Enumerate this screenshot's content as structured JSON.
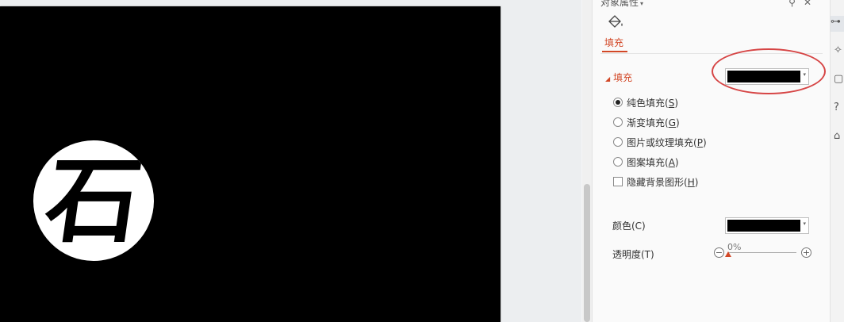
{
  "panel": {
    "title": "对象属性",
    "title_caret": "▾",
    "title_icons": [
      "pin-icon",
      "close-icon"
    ],
    "pin_glyph": "⚲",
    "close_glyph": "✕",
    "tab_fill_label": "填充",
    "section_title": "填充",
    "section_triangle": "◢",
    "fill_options": [
      {
        "label": "纯色填充(",
        "key": "S",
        "selected": true
      },
      {
        "label": "渐变填充(",
        "key": "G",
        "selected": false
      },
      {
        "label": "图片或纹理填充(",
        "key": "P",
        "selected": false
      },
      {
        "label": "图案填充(",
        "key": "A",
        "selected": false
      }
    ],
    "hide_bg_label": "隐藏背景图形(",
    "hide_bg_key": "H",
    "close_paren": ")",
    "color_label": "颜色(C)",
    "transparency_label": "透明度(T)",
    "transparency_value": "0%",
    "slider_minus": "−",
    "slider_plus": "+",
    "fill_swatch_color": "#000000",
    "accent_color": "#d24726",
    "highlight_color": "#d64545",
    "dropdown_arrow": "▾"
  },
  "slide": {
    "background_color": "#000000",
    "logo_char": "石"
  },
  "rail": {
    "icons": [
      "properties-icon",
      "magic-icon",
      "layout-icon",
      "help-icon",
      "backup-icon"
    ],
    "glyphs": [
      "⊶",
      "✧",
      "▢",
      "?",
      "⌂"
    ]
  }
}
